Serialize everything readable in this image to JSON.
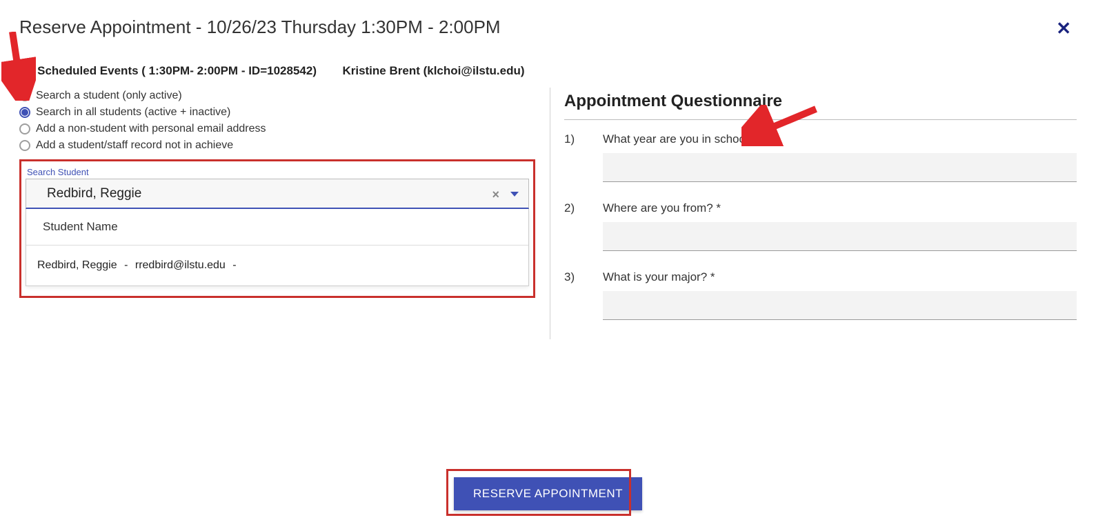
{
  "modal": {
    "title": "Reserve Appointment - 10/26/23 Thursday 1:30PM - 2:00PM",
    "close_glyph": "✕"
  },
  "subheader": {
    "event": "AT Scheduled Events ( 1:30PM- 2:00PM - ID=1028542)",
    "person": "Kristine Brent (klchoi@ilstu.edu)"
  },
  "radios": {
    "items": [
      {
        "label": "Search a student (only active)",
        "selected": false
      },
      {
        "label": "Search in all students (active + inactive)",
        "selected": true
      },
      {
        "label": "Add a non-student with personal email address",
        "selected": false
      },
      {
        "label": "Add a student/staff record not in achieve",
        "selected": false
      }
    ]
  },
  "search": {
    "label": "Search Student",
    "value": "Redbird, Reggie",
    "dropdown_header": "Student Name",
    "result": {
      "name": "Redbird, Reggie",
      "email": "rredbird@ilstu.edu"
    }
  },
  "questionnaire": {
    "title": "Appointment Questionnaire",
    "questions": [
      {
        "num": "1)",
        "label": "What year are you in school? *",
        "value": ""
      },
      {
        "num": "2)",
        "label": "Where are you from? *",
        "value": ""
      },
      {
        "num": "3)",
        "label": "What is your major? *",
        "value": ""
      }
    ]
  },
  "buttons": {
    "reserve": "RESERVE APPOINTMENT"
  },
  "annotations": {
    "arrow_color": "#e2262a",
    "box_color": "#c9302c"
  }
}
